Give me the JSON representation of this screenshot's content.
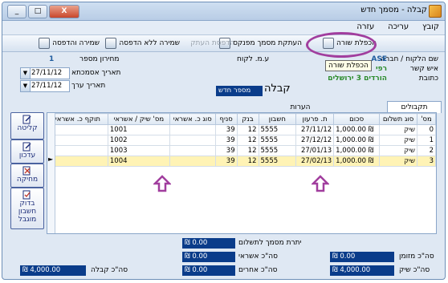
{
  "window": {
    "title": "קבלה - מסמך חדש",
    "controls": [
      "_",
      "□",
      "X"
    ]
  },
  "menu": [
    "קובץ",
    "עריכה",
    "עזרה"
  ],
  "toolbar": {
    "duplicate_row": "הכפלת שורה",
    "cancel_doc": "העתקת מסמך מפנקס",
    "print_copy": "הדפסת העתק",
    "save_no_print": "שמירה ללא הדפסה",
    "save_print": "שמירה והדפסה"
  },
  "tooltip": "הכפלת שורה",
  "form": {
    "customer_label": "שם הלקוח / חברה",
    "contact_label": "איש קשר",
    "address_label": "כתובת",
    "address_value": "הורדים 3 ירושלים",
    "company_code": "ASE",
    "company_partial": "רפי",
    "vat_label": "ע.מ. לקוח",
    "doc_type": "קבלה",
    "doc_number_label": "מספר חדש",
    "receipt_number_label": "מחירון מספר",
    "receipt_number_value": "1",
    "ref_date_label": "תאריך אסמכתא",
    "ref_date_value": "27/11/12",
    "value_date_label": "תאריך ערך",
    "value_date_value": "27/11/12"
  },
  "tabs": [
    "תקבולים",
    "הערות"
  ],
  "table": {
    "headers": [
      "מס'",
      "סוג תשלום",
      "סכום",
      "ת. פרעון",
      "חשבון",
      "בנק",
      "סניף",
      "סוג כ. אשראי",
      "מס' שיק / אשראי",
      "תוקף כ. אשראי"
    ],
    "rows": [
      [
        "0",
        "שיק",
        "₪ 1,000.00",
        "27/11/12",
        "5555",
        "12",
        "39",
        "",
        "1001",
        ""
      ],
      [
        "1",
        "שיק",
        "₪ 1,000.00",
        "27/12/12",
        "5555",
        "12",
        "39",
        "",
        "1002",
        ""
      ],
      [
        "2",
        "שיק",
        "₪ 1,000.00",
        "27/01/13",
        "5555",
        "12",
        "39",
        "",
        "1003",
        ""
      ],
      [
        "3",
        "שיק",
        "₪ 1,000.00",
        "27/02/13",
        "5555",
        "12",
        "39",
        "",
        "1004",
        ""
      ]
    ],
    "selected_row": 3
  },
  "side_buttons": [
    "קליטה",
    "עדכון",
    "מחיקה",
    "בדוק חשבון מוגבל"
  ],
  "summary": {
    "cash_label": "סה\"כ מזומן",
    "cash_value": "₪ 0.00",
    "check_label": "סה\"כ שיק",
    "check_value": "₪ 4,000.00",
    "balance_label": "יתרת מסמך לתשלום",
    "balance_value": "₪ 0.00",
    "credit_label": "סה\"כ אשראי",
    "credit_value": "₪ 0.00",
    "other_label": "סה\"כ אחרים",
    "other_value": "₪ 0.00",
    "receipt_label": "סה\"כ קבלה",
    "receipt_value": "₪ 4,000.00"
  },
  "colors": {
    "accent_oval": "#a13e9e",
    "selected_row": "#fff3b5",
    "sum_box": "#0a3c8a"
  }
}
